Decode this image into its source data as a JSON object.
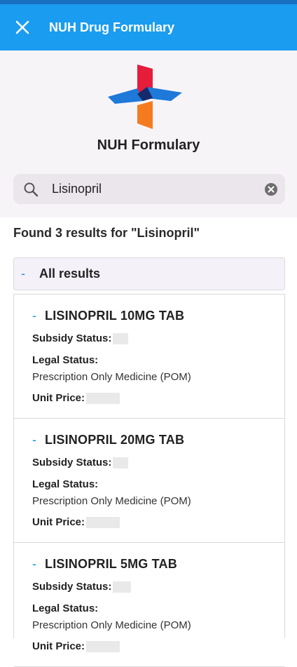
{
  "appbar": {
    "title": "NUH Drug Formulary",
    "close_icon": "close-icon"
  },
  "brand": {
    "name": "NUH Formulary",
    "logo_colors": {
      "red": "#e51c3a",
      "blue": "#1e79d9",
      "dark": "#152b6b",
      "orange": "#f47b20"
    }
  },
  "search": {
    "value": "Lisinopril",
    "search_icon": "search-icon",
    "clear_icon": "clear-icon"
  },
  "results": {
    "summary": "Found 3 results for \"Lisinopril\"",
    "group_label": "All results",
    "items": [
      {
        "name": "LISINOPRIL 10MG TAB",
        "subsidy_label": "Subsidy Status:",
        "legal_label": "Legal Status:",
        "legal_value": "Prescription Only Medicine (POM)",
        "price_label": "Unit Price:"
      },
      {
        "name": "LISINOPRIL 20MG TAB",
        "subsidy_label": "Subsidy Status:",
        "legal_label": "Legal Status:",
        "legal_value": "Prescription Only Medicine (POM)",
        "price_label": "Unit Price:"
      },
      {
        "name": "LISINOPRIL 5MG TAB",
        "subsidy_label": "Subsidy Status:",
        "legal_label": "Legal Status:",
        "legal_value": "Prescription Only Medicine (POM)",
        "price_label": "Unit Price:"
      }
    ]
  },
  "colors": {
    "appbar": "#1a9cf0",
    "accent": "#1a8fe3"
  }
}
